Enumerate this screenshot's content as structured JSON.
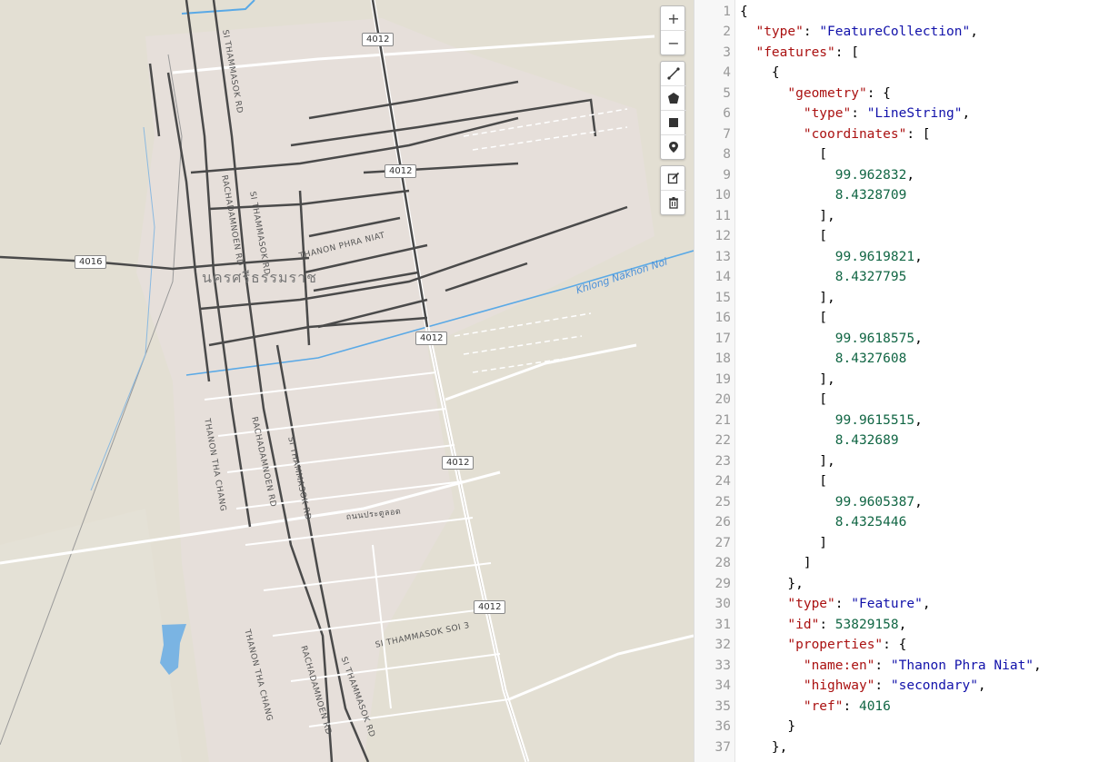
{
  "map": {
    "city_label": "นครศรีธรรมราช",
    "water_label": "Khlong Nakhon Noi",
    "road_shields": [
      "4012",
      "4012",
      "4012",
      "4012",
      "4012",
      "4016"
    ],
    "road_labels": {
      "si_thammasok_1": "SI THAMMASOK RD",
      "si_thammasok_2": "SI THAMMASOK RD",
      "si_thammasok_3": "SI THAMMASOK RD",
      "si_thammasok_4": "SI THAMMASOK RD",
      "rachadamnoen_1": "RACHADAMNOEN RD",
      "rachadamnoen_2": "RACHADAMNOEN RD",
      "rachadamnoen_3": "RACHADAMNOEN RD",
      "phra_niat": "THANON PHRA NIAT",
      "tha_chang_1": "THANON THA CHANG",
      "tha_chang_2": "THANON THA CHANG",
      "pratu_lot": "ถนนประตูลอด",
      "soi3": "SI THAMMASOK SOI 3"
    },
    "colors": {
      "land": "#e3dfd3",
      "urban": "#e8e0dc",
      "road": "#555555",
      "water": "#5aa9e6",
      "major_road": "#ffffff"
    }
  },
  "toolbar": {
    "zoom_in": "+",
    "zoom_out": "−",
    "icons": [
      "line-icon",
      "polygon-icon",
      "rectangle-icon",
      "marker-icon",
      "edit-icon",
      "trash-icon"
    ]
  },
  "editor": {
    "line_numbers": [
      "1",
      "2",
      "3",
      "4",
      "5",
      "6",
      "7",
      "8",
      "9",
      "10",
      "11",
      "12",
      "13",
      "14",
      "15",
      "16",
      "17",
      "18",
      "19",
      "20",
      "21",
      "22",
      "23",
      "24",
      "25",
      "26",
      "27",
      "28",
      "29",
      "30",
      "31",
      "32",
      "33",
      "34",
      "35",
      "36",
      "37"
    ],
    "lines": [
      "{",
      "  \"type\": \"FeatureCollection\",",
      "  \"features\": [",
      "    {",
      "      \"geometry\": {",
      "        \"type\": \"LineString\",",
      "        \"coordinates\": [",
      "          [",
      "            99.962832,",
      "            8.4328709",
      "          ],",
      "          [",
      "            99.9619821,",
      "            8.4327795",
      "          ],",
      "          [",
      "            99.9618575,",
      "            8.4327608",
      "          ],",
      "          [",
      "            99.9615515,",
      "            8.432689",
      "          ],",
      "          [",
      "            99.9605387,",
      "            8.4325446",
      "          ]",
      "        ]",
      "      },",
      "      \"type\": \"Feature\",",
      "      \"id\": 53829158,",
      "      \"properties\": {",
      "        \"name:en\": \"Thanon Phra Niat\",",
      "        \"highway\": \"secondary\",",
      "        \"ref\": 4016",
      "      }",
      "    },"
    ]
  }
}
